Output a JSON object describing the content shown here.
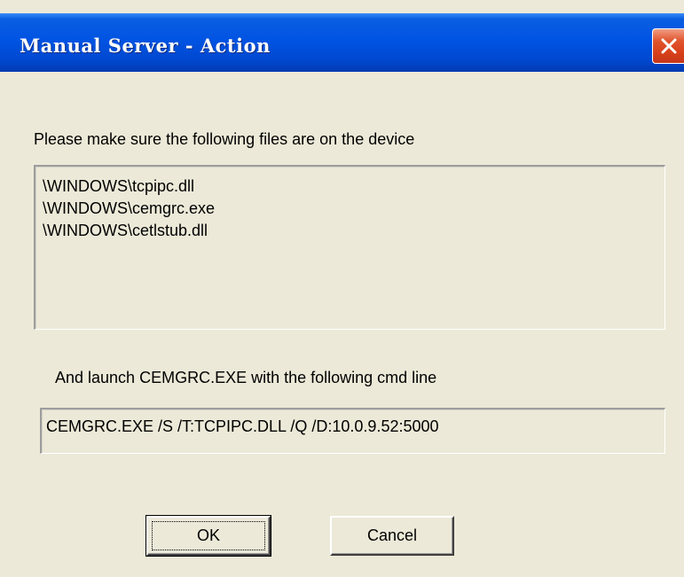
{
  "window": {
    "title": "Manual Server - Action"
  },
  "instructions": {
    "files_prompt": "Please make sure the following files are on the device",
    "files": [
      "\\WINDOWS\\tcpipc.dll",
      "\\WINDOWS\\cemgrc.exe",
      "\\WINDOWS\\cetlstub.dll"
    ],
    "launch_prompt": "And launch CEMGRC.EXE with the following cmd line",
    "cmd_line": "CEMGRC.EXE /S /T:TCPIPC.DLL /Q  /D:10.0.9.52:5000"
  },
  "buttons": {
    "ok_label": "OK",
    "cancel_label": "Cancel"
  },
  "icons": {
    "close": "close-icon"
  },
  "colors": {
    "titlebar": "#0054e3",
    "dialog_bg": "#ece9d8",
    "close_button": "#e0542d"
  }
}
